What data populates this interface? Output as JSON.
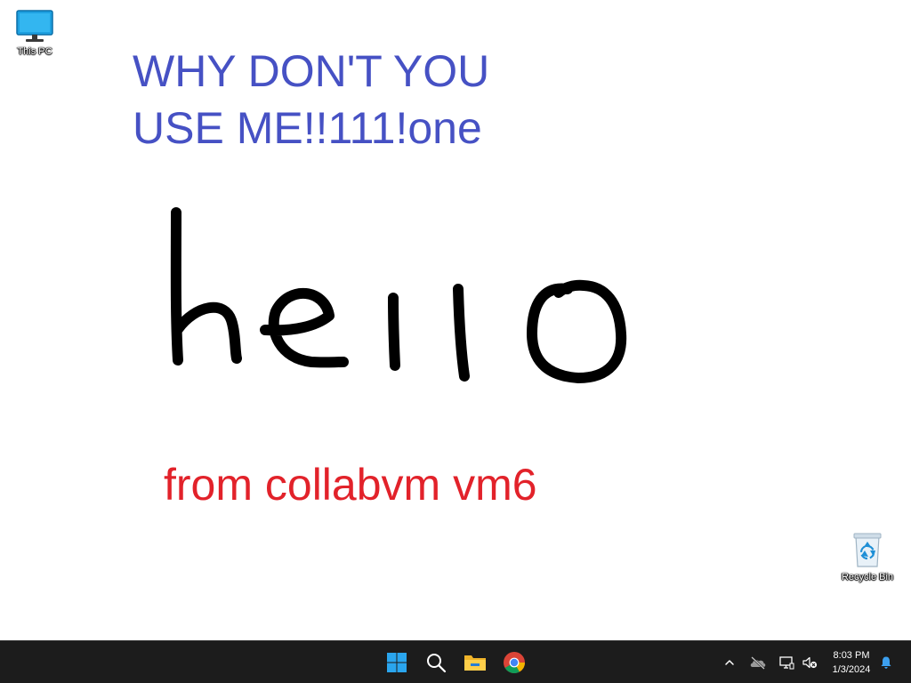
{
  "desktop": {
    "icons": [
      {
        "name": "this-pc",
        "label": "This PC",
        "icon": "monitor-icon"
      },
      {
        "name": "recycle-bin",
        "label": "Recycle Bin",
        "icon": "recycle-bin-icon"
      }
    ]
  },
  "wallpaper": {
    "line1": "WHY DON'T YOU",
    "line2": "USE ME!!111!one",
    "handwriting": "hello",
    "footer": "from collabvm vm6",
    "colors": {
      "blue": "#4651c4",
      "red": "#e2222a",
      "ink": "#000000"
    }
  },
  "taskbar": {
    "buttons": [
      {
        "name": "start-button",
        "icon": "windows-logo-icon"
      },
      {
        "name": "search-button",
        "icon": "search-icon"
      },
      {
        "name": "file-explorer-button",
        "icon": "folder-icon"
      },
      {
        "name": "chrome-button",
        "icon": "chrome-icon"
      }
    ],
    "tray": {
      "icons": [
        "chevron-up-icon",
        "onedrive-offline-icon",
        "network-icon",
        "volume-muted-icon",
        "notification-bell-icon"
      ],
      "time": "8:03 PM",
      "date": "1/3/2024"
    },
    "background": "#1c1c1c"
  }
}
